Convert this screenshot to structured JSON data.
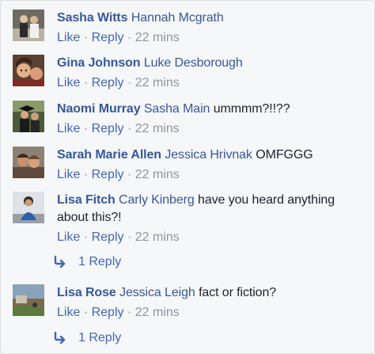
{
  "comments": [
    {
      "author": "Sasha Witts",
      "tag": "Hannah Mcgrath",
      "text": "",
      "actions": {
        "like": "Like",
        "reply": "Reply",
        "sep": "·",
        "time": "22 mins"
      }
    },
    {
      "author": "Gina Johnson",
      "tag": "Luke Desborough",
      "text": "",
      "actions": {
        "like": "Like",
        "reply": "Reply",
        "sep": "·",
        "time": "22 mins"
      }
    },
    {
      "author": "Naomi Murray",
      "tag": "Sasha Main",
      "text": "ummmm?!!??",
      "actions": {
        "like": "Like",
        "reply": "Reply",
        "sep": "·",
        "time": "22 mins"
      }
    },
    {
      "author": "Sarah Marie Allen",
      "tag": "Jessica Hrivnak",
      "text": "OMFGGG",
      "actions": {
        "like": "Like",
        "reply": "Reply",
        "sep": "·",
        "time": "22 mins"
      }
    },
    {
      "author": "Lisa Fitch",
      "tag": "Carly Kinberg",
      "text": "have you heard anything",
      "text2": "about this?!",
      "actions": {
        "like": "Like",
        "reply": "Reply",
        "sep": "·",
        "time": "22 mins"
      },
      "replies": "1 Reply"
    },
    {
      "author": "Lisa Rose",
      "tag": "Jessica Leigh",
      "text": "fact or fiction?",
      "actions": {
        "like": "Like",
        "reply": "Reply",
        "sep": "·",
        "time": "22 mins"
      },
      "replies": "1 Reply"
    }
  ],
  "colors": {
    "link": "#365899",
    "action": "#4267b2",
    "meta": "#90949c",
    "text": "#1d2129",
    "background": "#f6f7f9"
  },
  "icons": {
    "reply_arrow": "reply-arrow-icon"
  }
}
